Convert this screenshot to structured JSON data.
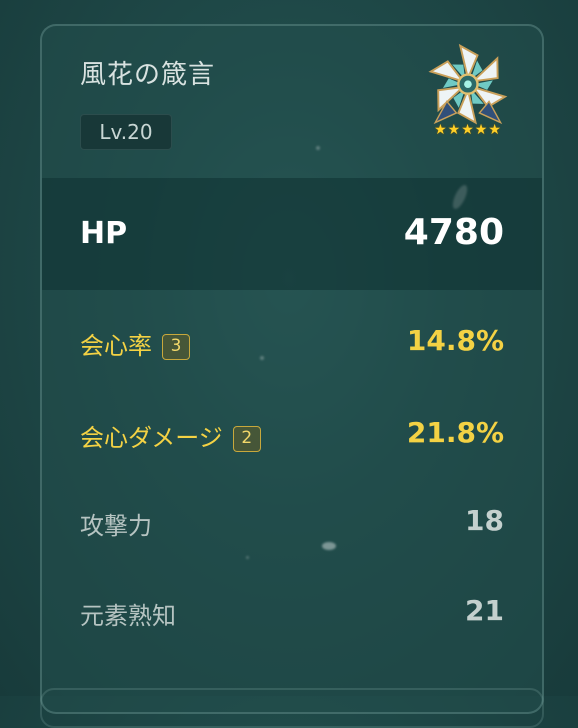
{
  "artifact": {
    "name": "風花の箴言",
    "level": "Lv.20",
    "rarity_stars": "★★★★★",
    "icon": "windblume-flower-artifact-icon"
  },
  "main_stat": {
    "name": "HP",
    "value": "4780"
  },
  "substats": [
    {
      "name": "会心率",
      "rolls": "3",
      "value": "14.8%",
      "highlight": true
    },
    {
      "name": "会心ダメージ",
      "rolls": "2",
      "value": "21.8%",
      "highlight": true
    },
    {
      "name": "攻撃力",
      "value": "18",
      "highlight": false
    },
    {
      "name": "元素熟知",
      "value": "21",
      "highlight": false
    }
  ],
  "colors": {
    "highlight_gold": "#f4d244",
    "panel_teal": "#1f4948",
    "star_gold": "#ffd028"
  }
}
